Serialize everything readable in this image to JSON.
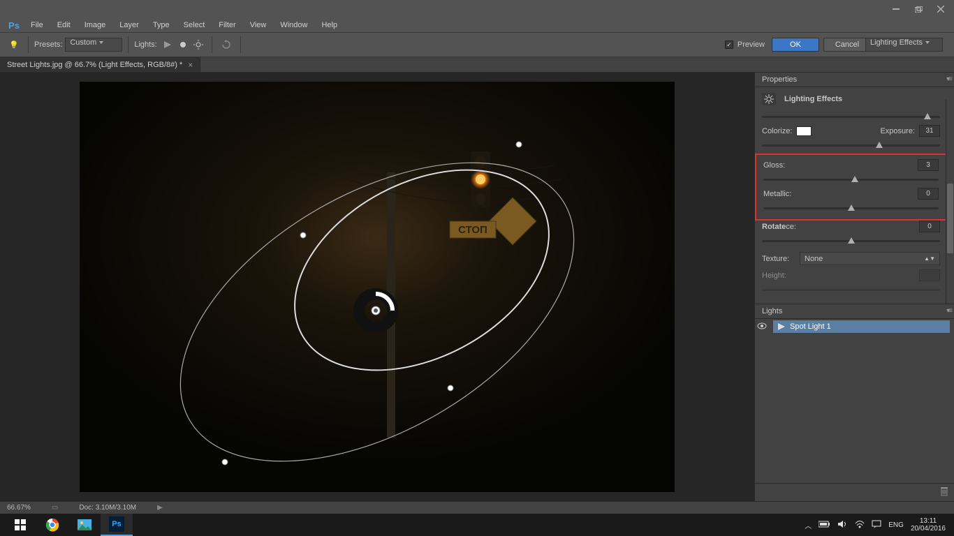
{
  "menu": {
    "items": [
      "File",
      "Edit",
      "Image",
      "Layer",
      "Type",
      "Select",
      "Filter",
      "View",
      "Window",
      "Help"
    ]
  },
  "options": {
    "presets_label": "Presets:",
    "presets_value": "Custom",
    "lights_label": "Lights:",
    "preview_label": "Preview",
    "ok": "OK",
    "cancel": "Cancel",
    "right_dropdown": "Lighting Effects"
  },
  "document": {
    "tab": "Street Lights.jpg @ 66.7% (Light Effects, RGB/8#) *"
  },
  "properties": {
    "title": "Properties",
    "header": "Lighting Effects",
    "colorize": "Colorize:",
    "exposure": "Exposure:",
    "exposure_value": "31",
    "gloss": "Gloss:",
    "gloss_value": "3",
    "metallic": "Metallic:",
    "metallic_value": "0",
    "rotate": "Rotate",
    "rotate_suffix": "ce:",
    "rotate_value": "0",
    "texture": "Texture:",
    "texture_value": "None",
    "height": "Height:"
  },
  "lights_panel": {
    "title": "Lights",
    "item": "Spot Light 1"
  },
  "status": {
    "zoom": "66.67%",
    "doc": "Doc: 3.10M/3.10M"
  },
  "taskbar": {
    "lang": "ENG",
    "time": "13:11",
    "date": "20/04/2016"
  },
  "canvas_sign": "СТОП"
}
